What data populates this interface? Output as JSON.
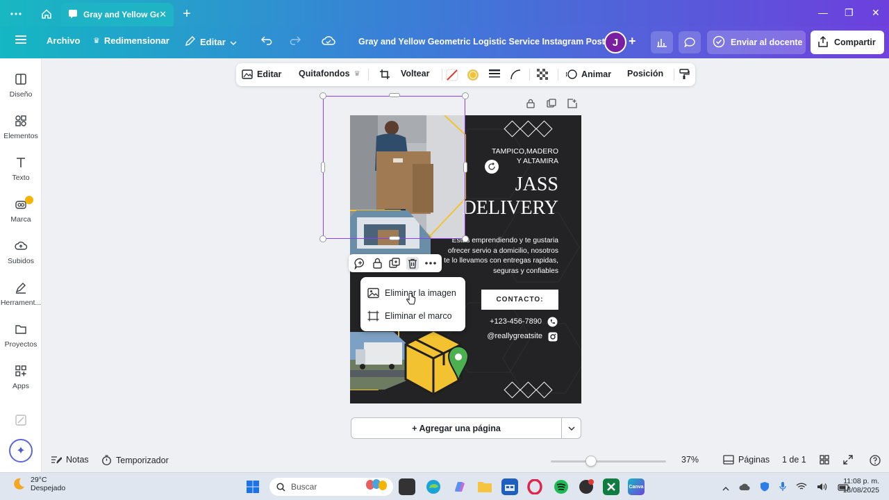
{
  "browser": {
    "tab_title": "Gray and Yellow Ge...",
    "new_tab_symbol": "+"
  },
  "header": {
    "file_label": "Archivo",
    "resize_label": "Redimensionar",
    "edit_label": "Editar",
    "doc_title": "Gray and Yellow Geometric Logistic Service Instagram Post",
    "avatar_initial": "J",
    "send_label": "Enviar al docente",
    "share_label": "Compartir"
  },
  "sidebar": {
    "items": [
      {
        "label": "Diseño",
        "icon": "design-icon"
      },
      {
        "label": "Elementos",
        "icon": "elements-icon"
      },
      {
        "label": "Texto",
        "icon": "text-icon"
      },
      {
        "label": "Marca",
        "icon": "brand-icon"
      },
      {
        "label": "Subidos",
        "icon": "uploads-icon"
      },
      {
        "label": "Herrament...",
        "icon": "tools-icon"
      },
      {
        "label": "Proyectos",
        "icon": "projects-icon"
      },
      {
        "label": "Apps",
        "icon": "apps-icon"
      }
    ]
  },
  "toolbar": {
    "edit": "Editar",
    "bg_remover": "Quitafondos",
    "flip": "Voltear",
    "animate": "Animar",
    "position": "Posición"
  },
  "design": {
    "location": "TAMPICO,MADERO\nY ALTAMIRA",
    "brand_line1": "JASS",
    "brand_line2": "DELIVERY",
    "description": "Estas emprendiendo y te gustaria ofrecer servio a domicilio, nosotros te lo llevamos con entregas rapidas, seguras y confiables",
    "contact_label": "CONTACTO:",
    "phone": "+123-456-7890",
    "social": "@reallygreatsite",
    "accent_color": "#f2c230",
    "bg_color": "#232325"
  },
  "context_menu": {
    "remove_image": "Eliminar la imagen",
    "remove_frame": "Eliminar el marco"
  },
  "add_page_label": "+ Agregar una página",
  "bottom": {
    "notes": "Notas",
    "timer": "Temporizador",
    "zoom": "37%",
    "pages_label": "Páginas",
    "page_count": "1 de 1"
  },
  "taskbar": {
    "temperature": "29°C",
    "weather": "Despejado",
    "search_placeholder": "Buscar",
    "time": "11:08 p. m.",
    "date": "18/08/2025"
  }
}
